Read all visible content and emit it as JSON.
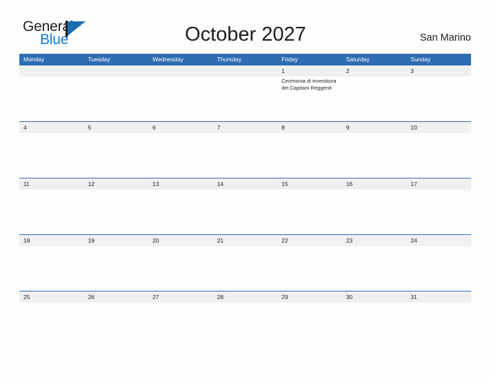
{
  "brand": {
    "name_part1": "General",
    "name_part2": "Blue",
    "flag_icon": "triangle-flag-icon",
    "primary_color": "#1b6cb0",
    "text_color": "#231f20"
  },
  "header": {
    "title": "October 2027",
    "location": "San Marino"
  },
  "colors": {
    "header_blue": "#2e6db4",
    "row_band_gray": "#f0f0f0",
    "page_background": "#fdfdfd",
    "text_dark": "#232323"
  },
  "calendar": {
    "month": "October",
    "year": "2027",
    "day_headers": [
      "Monday",
      "Tuesday",
      "Wednesday",
      "Thursday",
      "Friday",
      "Saturday",
      "Sunday"
    ],
    "weeks": [
      {
        "days": [
          {
            "date": "",
            "events": []
          },
          {
            "date": "",
            "events": []
          },
          {
            "date": "",
            "events": []
          },
          {
            "date": "",
            "events": []
          },
          {
            "date": "1",
            "events": [
              "Cerimonia di investitura dei Capitani Reggenti"
            ]
          },
          {
            "date": "2",
            "events": []
          },
          {
            "date": "3",
            "events": []
          }
        ]
      },
      {
        "days": [
          {
            "date": "4",
            "events": []
          },
          {
            "date": "5",
            "events": []
          },
          {
            "date": "6",
            "events": []
          },
          {
            "date": "7",
            "events": []
          },
          {
            "date": "8",
            "events": []
          },
          {
            "date": "9",
            "events": []
          },
          {
            "date": "10",
            "events": []
          }
        ]
      },
      {
        "days": [
          {
            "date": "11",
            "events": []
          },
          {
            "date": "12",
            "events": []
          },
          {
            "date": "13",
            "events": []
          },
          {
            "date": "14",
            "events": []
          },
          {
            "date": "15",
            "events": []
          },
          {
            "date": "16",
            "events": []
          },
          {
            "date": "17",
            "events": []
          }
        ]
      },
      {
        "days": [
          {
            "date": "18",
            "events": []
          },
          {
            "date": "19",
            "events": []
          },
          {
            "date": "20",
            "events": []
          },
          {
            "date": "21",
            "events": []
          },
          {
            "date": "22",
            "events": []
          },
          {
            "date": "23",
            "events": []
          },
          {
            "date": "24",
            "events": []
          }
        ]
      },
      {
        "days": [
          {
            "date": "25",
            "events": []
          },
          {
            "date": "26",
            "events": []
          },
          {
            "date": "27",
            "events": []
          },
          {
            "date": "28",
            "events": []
          },
          {
            "date": "29",
            "events": []
          },
          {
            "date": "30",
            "events": []
          },
          {
            "date": "31",
            "events": []
          }
        ]
      }
    ]
  }
}
